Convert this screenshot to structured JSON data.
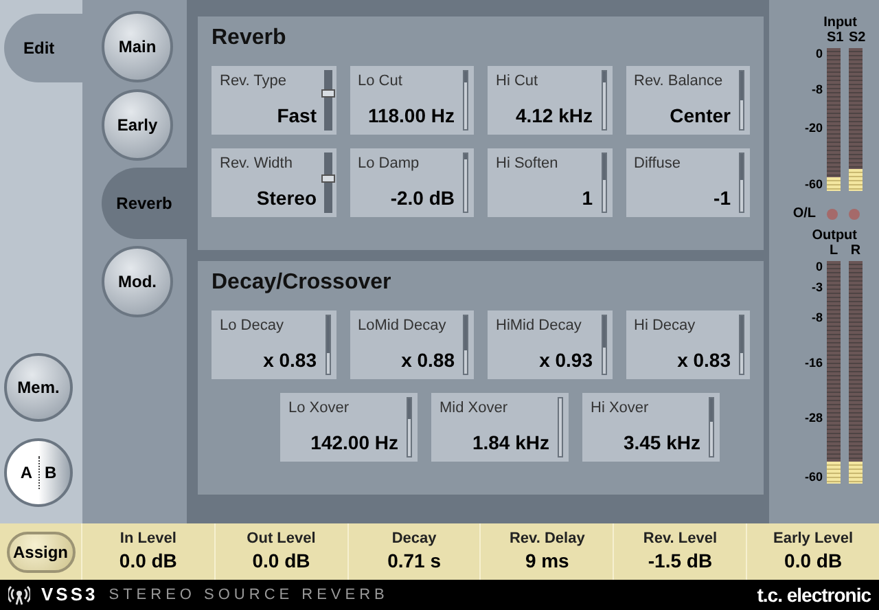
{
  "edit_tab": {
    "label": "Edit",
    "selected": true
  },
  "nav": [
    {
      "label": "Main",
      "selected": false
    },
    {
      "label": "Early",
      "selected": false
    },
    {
      "label": "Reverb",
      "selected": true
    },
    {
      "label": "Mod.",
      "selected": false
    }
  ],
  "mem_button": "Mem.",
  "ab_toggle": {
    "a": "A",
    "b": "B"
  },
  "sections": [
    {
      "title": "Reverb",
      "rows": [
        {
          "params": [
            {
              "kind": "switch",
              "label": "Rev. Type",
              "value": "Fast",
              "level": 0.63
            },
            {
              "kind": "fader",
              "label": "Lo Cut",
              "value": "118.00 Hz",
              "level": 0.2
            },
            {
              "kind": "fader",
              "label": "Hi Cut",
              "value": "4.12 kHz",
              "level": 0.2
            },
            {
              "kind": "fader",
              "label": "Rev. Balance",
              "value": "Center",
              "level": 0.5
            }
          ]
        },
        {
          "params": [
            {
              "kind": "switch",
              "label": "Rev. Width",
              "value": "Stereo",
              "level": 0.59
            },
            {
              "kind": "fader",
              "label": "Lo Damp",
              "value": "-2.0 dB",
              "level": 0.1
            },
            {
              "kind": "fader",
              "label": "Hi Soften",
              "value": "1",
              "level": 0.45
            },
            {
              "kind": "fader",
              "label": "Diffuse",
              "value": "-1",
              "level": 0.45
            }
          ]
        }
      ]
    },
    {
      "title": "Decay/Crossover",
      "rows": [
        {
          "params": [
            {
              "kind": "fader",
              "label": "Lo Decay",
              "value": "x 0.83",
              "level": 0.65
            },
            {
              "kind": "fader",
              "label": "LoMid Decay",
              "value": "x 0.88",
              "level": 0.6
            },
            {
              "kind": "fader",
              "label": "HiMid Decay",
              "value": "x 0.93",
              "level": 0.55
            },
            {
              "kind": "fader",
              "label": "Hi Decay",
              "value": "x 0.83",
              "level": 0.65
            }
          ]
        },
        {
          "params": [
            {
              "kind": "fader",
              "label": "Lo Xover",
              "value": "142.00 Hz",
              "level": 0.35
            },
            {
              "kind": "fader",
              "label": "Mid Xover",
              "value": "1.84 kHz"
            },
            {
              "kind": "fader",
              "label": "Hi Xover",
              "value": "3.45 kHz",
              "level": 0.4
            }
          ]
        }
      ]
    }
  ],
  "input_meters": {
    "title": "Input",
    "channels": [
      {
        "name": "S1",
        "level": 0.1
      },
      {
        "name": "S2",
        "level": 0.15
      }
    ],
    "scale": [
      "0",
      "-8",
      "-20",
      "-60"
    ]
  },
  "overload_label": "O/L",
  "output_meters": {
    "title": "Output",
    "channels": [
      {
        "name": "L",
        "level": 0.1
      },
      {
        "name": "R",
        "level": 0.1
      }
    ],
    "scale": [
      "0",
      "-3",
      "-8",
      "-16",
      "-28",
      "-60"
    ]
  },
  "assign_button": "Assign",
  "readouts": [
    {
      "label": "In Level",
      "value": "0.0 dB"
    },
    {
      "label": "Out Level",
      "value": "0.0 dB"
    },
    {
      "label": "Decay",
      "value": "0.71 s"
    },
    {
      "label": "Rev. Delay",
      "value": "9 ms"
    },
    {
      "label": "Rev. Level",
      "value": "-1.5 dB"
    },
    {
      "label": "Early Level",
      "value": "0.0 dB"
    }
  ],
  "footer": {
    "product": "VSS3",
    "subtitle": "STEREO SOURCE REVERB",
    "brand": "t.c. electronic"
  }
}
